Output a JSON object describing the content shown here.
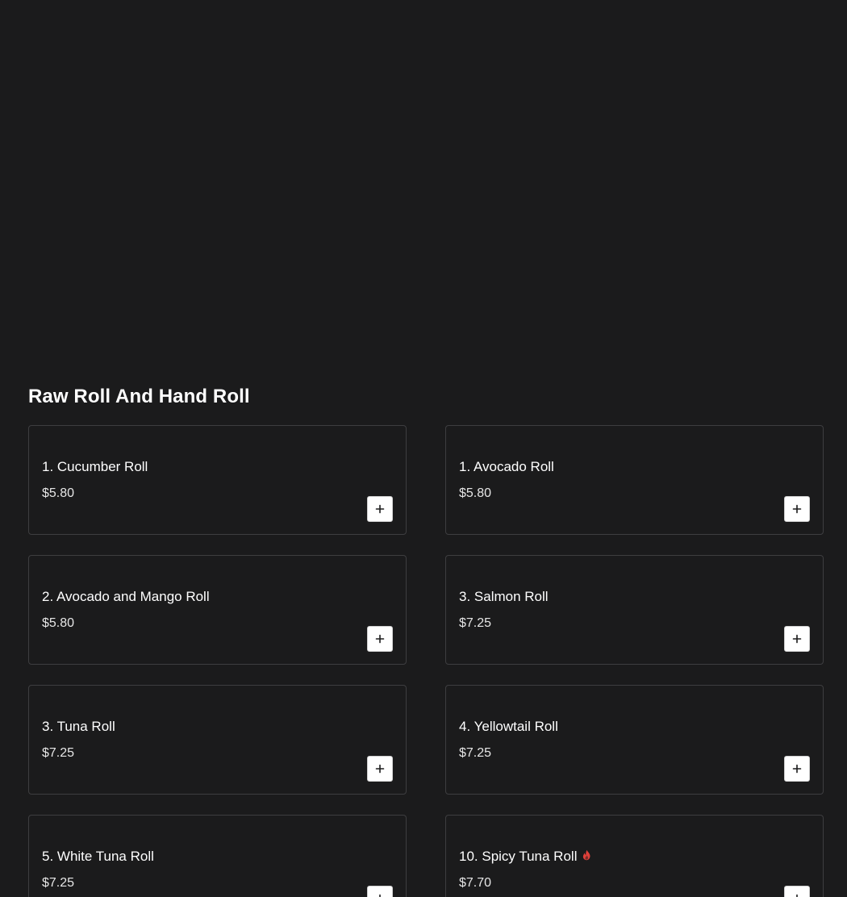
{
  "section": {
    "title": "Raw Roll And Hand Roll"
  },
  "items": [
    {
      "name": "1. Cucumber Roll",
      "price": "$5.80",
      "spicy": false
    },
    {
      "name": "1. Avocado Roll",
      "price": "$5.80",
      "spicy": false
    },
    {
      "name": "2. Avocado and Mango Roll",
      "price": "$5.80",
      "spicy": false
    },
    {
      "name": "3. Salmon Roll",
      "price": "$7.25",
      "spicy": false
    },
    {
      "name": "3. Tuna Roll",
      "price": "$7.25",
      "spicy": false
    },
    {
      "name": "4. Yellowtail Roll",
      "price": "$7.25",
      "spicy": false
    },
    {
      "name": "5. White Tuna Roll",
      "price": "$7.25",
      "spicy": false
    },
    {
      "name": "10. Spicy Tuna Roll",
      "price": "$7.70",
      "spicy": true
    }
  ],
  "icons": {
    "add": "plus-icon",
    "spicy": "flame-icon"
  },
  "colors": {
    "background": "#1b1b1c",
    "card_border": "#3e3e40",
    "spicy": "#e0403a",
    "add_button_bg": "#ffffff"
  }
}
